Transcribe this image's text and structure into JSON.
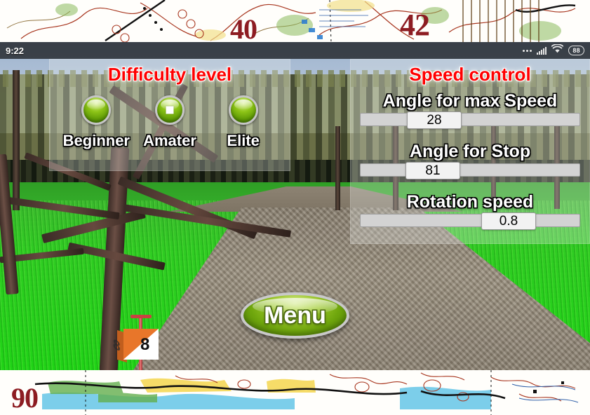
{
  "status_bar": {
    "time": "9:22",
    "battery_level": "88",
    "icons": [
      "more-dots-icon",
      "signal-bars-icon",
      "wifi-icon",
      "battery-icon"
    ]
  },
  "map_border": {
    "top_numbers": [
      "40",
      "42"
    ],
    "bottom_numbers": [
      "90"
    ]
  },
  "difficulty_panel": {
    "title": "Difficulty level",
    "title_color": "#ff0000",
    "options": [
      {
        "label": "Beginner",
        "selected": false
      },
      {
        "label": "Amater",
        "selected": true
      },
      {
        "label": "Elite",
        "selected": false
      }
    ]
  },
  "speed_panel": {
    "title": "Speed control",
    "title_color": "#ff0000",
    "sliders": [
      {
        "label": "Angle for max Speed",
        "value": "28",
        "percent": 28
      },
      {
        "label": "Angle for Stop",
        "value": "81",
        "percent": 27
      },
      {
        "label": "Rotation speed",
        "value": "0.8",
        "percent": 73
      }
    ]
  },
  "scene": {
    "control_flag_number": "8"
  },
  "menu_button": {
    "label": "Menu"
  }
}
